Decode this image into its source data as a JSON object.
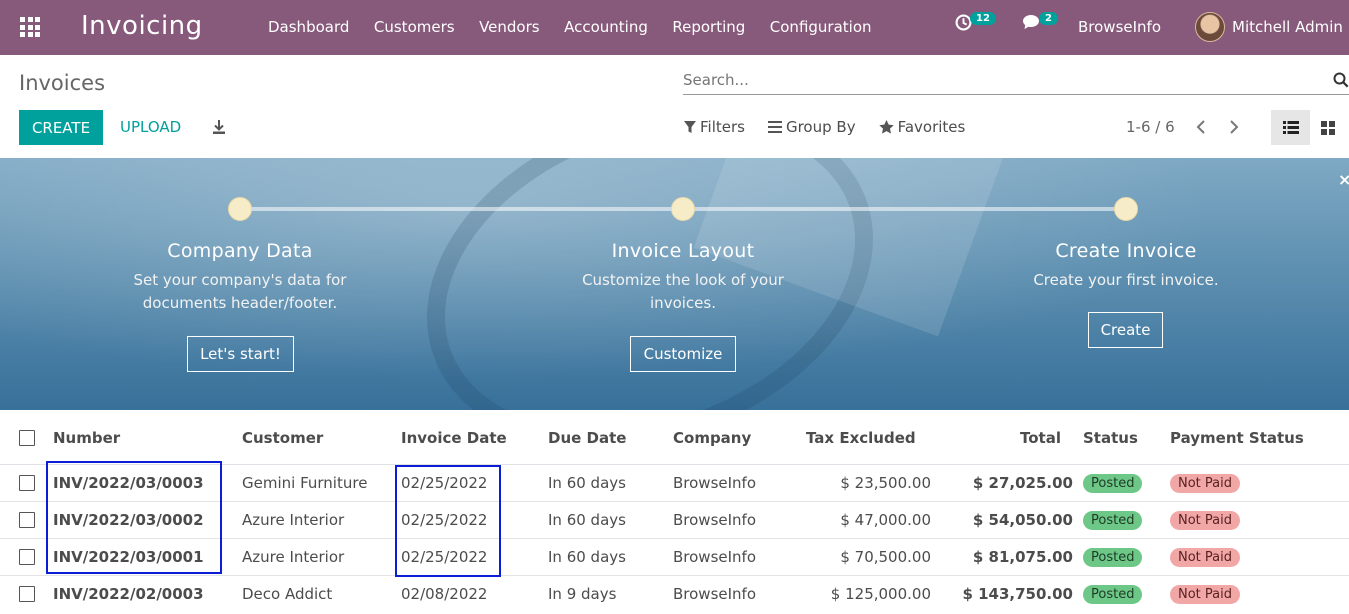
{
  "navbar": {
    "app_title": "Invoicing",
    "menu": [
      "Dashboard",
      "Customers",
      "Vendors",
      "Accounting",
      "Reporting",
      "Configuration"
    ],
    "activity_count": "12",
    "messages_count": "2",
    "company": "BrowseInfo",
    "user": "Mitchell Admin"
  },
  "control_panel": {
    "title": "Invoices",
    "search_placeholder": "Search...",
    "create_label": "CREATE",
    "upload_label": "UPLOAD",
    "filters_label": "Filters",
    "groupby_label": "Group By",
    "favorites_label": "Favorites",
    "pager": "1-6 / 6"
  },
  "onboarding": {
    "steps": [
      {
        "title": "Company Data",
        "desc_line1": "Set your company's data for",
        "desc_line2": "documents header/footer.",
        "button": "Let's start!"
      },
      {
        "title": "Invoice Layout",
        "desc_line1": "Customize the look of your",
        "desc_line2": "invoices.",
        "button": "Customize"
      },
      {
        "title": "Create Invoice",
        "desc_line1": "Create your first invoice.",
        "desc_line2": "",
        "button": "Create"
      }
    ],
    "close": "×"
  },
  "table": {
    "headers": [
      "Number",
      "Customer",
      "Invoice Date",
      "Due Date",
      "Company",
      "Tax Excluded",
      "Total",
      "Status",
      "Payment Status"
    ],
    "rows": [
      {
        "number": "INV/2022/03/0003",
        "customer": "Gemini Furniture",
        "invoice_date": "02/25/2022",
        "due_date": "In 60 days",
        "company": "BrowseInfo",
        "tax_excluded": "$ 23,500.00",
        "total": "$ 27,025.00",
        "status": "Posted",
        "payment_status": "Not Paid"
      },
      {
        "number": "INV/2022/03/0002",
        "customer": "Azure Interior",
        "invoice_date": "02/25/2022",
        "due_date": "In 60 days",
        "company": "BrowseInfo",
        "tax_excluded": "$ 47,000.00",
        "total": "$ 54,050.00",
        "status": "Posted",
        "payment_status": "Not Paid"
      },
      {
        "number": "INV/2022/03/0001",
        "customer": "Azure Interior",
        "invoice_date": "02/25/2022",
        "due_date": "In 60 days",
        "company": "BrowseInfo",
        "tax_excluded": "$ 70,500.00",
        "total": "$ 81,075.00",
        "status": "Posted",
        "payment_status": "Not Paid"
      },
      {
        "number": "INV/2022/02/0003",
        "customer": "Deco Addict",
        "invoice_date": "02/08/2022",
        "due_date": "In 9 days",
        "company": "BrowseInfo",
        "tax_excluded": "$ 125,000.00",
        "total": "$ 143,750.00",
        "status": "Posted",
        "payment_status": "Not Paid"
      }
    ]
  },
  "colors": {
    "navbar": "#875a7b",
    "primary": "#00a09d",
    "highlight_box": "#0b1ed6",
    "posted": "#6dc787",
    "not_paid": "#f2a7a7"
  },
  "icons": [
    "apps-grid-icon",
    "activity-clock-icon",
    "chat-icon",
    "download-icon",
    "search-icon",
    "filter-icon",
    "group-by-icon",
    "star-icon",
    "chevron-left-icon",
    "chevron-right-icon",
    "list-view-icon",
    "kanban-view-icon",
    "close-icon"
  ]
}
